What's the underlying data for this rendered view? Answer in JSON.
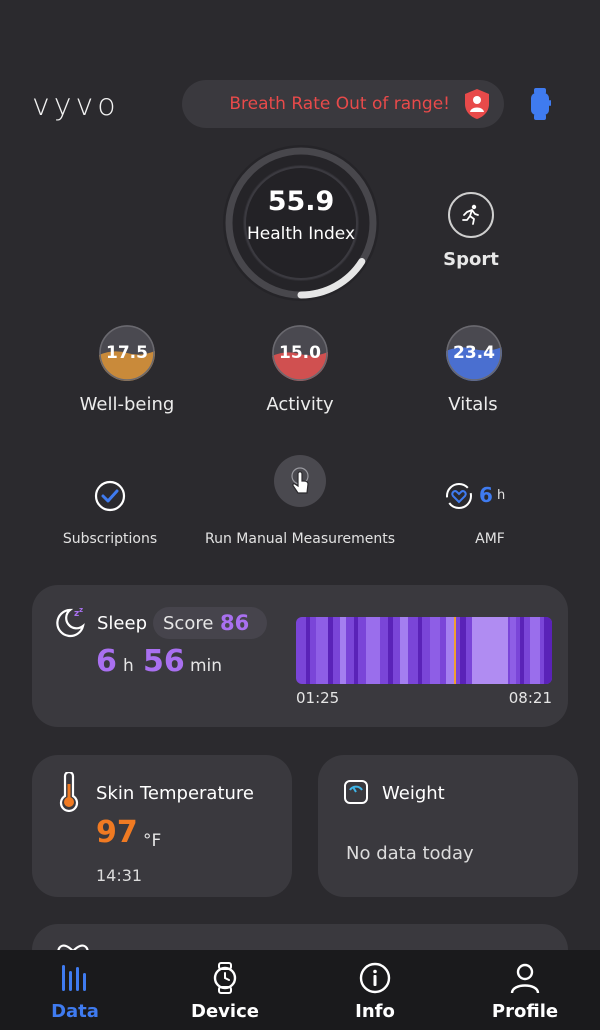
{
  "header": {
    "logo": "vyvo",
    "alert_text": "Breath Rate Out of range!"
  },
  "health_index": {
    "value": "55.9",
    "label": "Health Index",
    "progress": 0.16
  },
  "sport": {
    "label": "Sport"
  },
  "scores": [
    {
      "value": "17.5",
      "label": "Well-being",
      "color": "#c98a3a"
    },
    {
      "value": "15.0",
      "label": "Activity",
      "color": "#d05050"
    },
    {
      "value": "23.4",
      "label": "Vitals",
      "color": "#4a6fd0"
    }
  ],
  "actions": {
    "subscriptions": "Subscriptions",
    "manual": "Run Manual Measurements",
    "amf_label": "AMF",
    "amf_value": "6",
    "amf_unit": "h"
  },
  "sleep": {
    "title": "Sleep",
    "score_label": "Score",
    "score": "86",
    "hours": "6",
    "hours_unit": "h",
    "minutes": "56",
    "minutes_unit": "min",
    "start": "01:25",
    "end": "08:21"
  },
  "skin_temp": {
    "title": "Skin Temperature",
    "value": "97",
    "unit": "°F",
    "time": "14:31"
  },
  "weight": {
    "title": "Weight",
    "status": "No data today"
  },
  "nav": [
    {
      "label": "Data",
      "icon": "bars-icon"
    },
    {
      "label": "Device",
      "icon": "watch-icon"
    },
    {
      "label": "Info",
      "icon": "info-icon"
    },
    {
      "label": "Profile",
      "icon": "person-icon"
    }
  ],
  "colors": {
    "accent_blue": "#3f7bf0",
    "alert_red": "#e84a4a",
    "sleep_purple": "#a970f0",
    "temp_orange": "#f07a22"
  }
}
